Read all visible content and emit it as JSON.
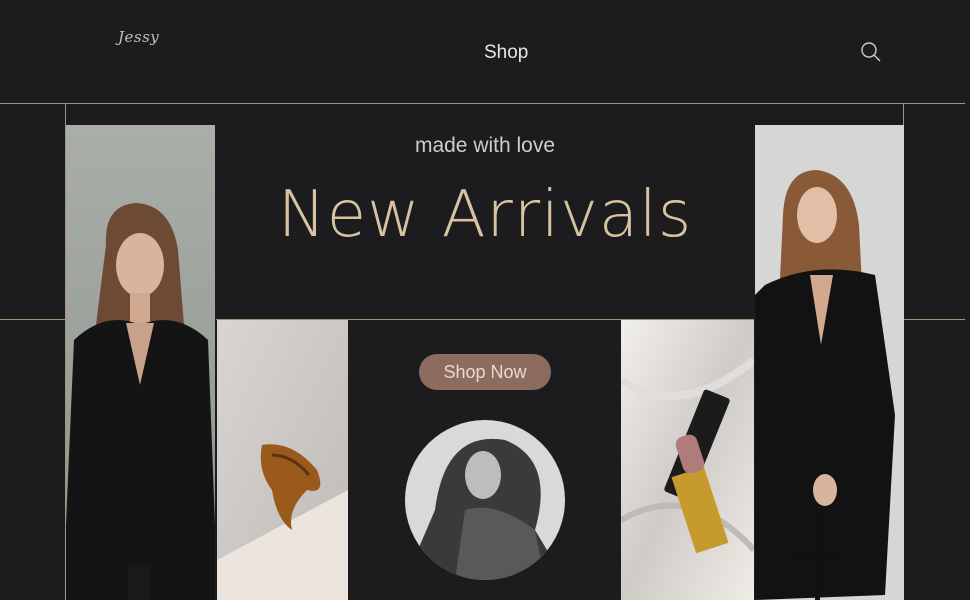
{
  "header": {
    "logo_text": "Jessy",
    "nav_shop_label": "Shop",
    "search_icon": "search-icon"
  },
  "hero": {
    "tagline": "made with love",
    "headline": "New Arrivals",
    "cta_label": "Shop Now"
  },
  "theme": {
    "background": "#1c1c1e",
    "accent_gold": "#d7c3a1",
    "line_color": "#a4937a",
    "button_color": "#8b6c5e"
  }
}
